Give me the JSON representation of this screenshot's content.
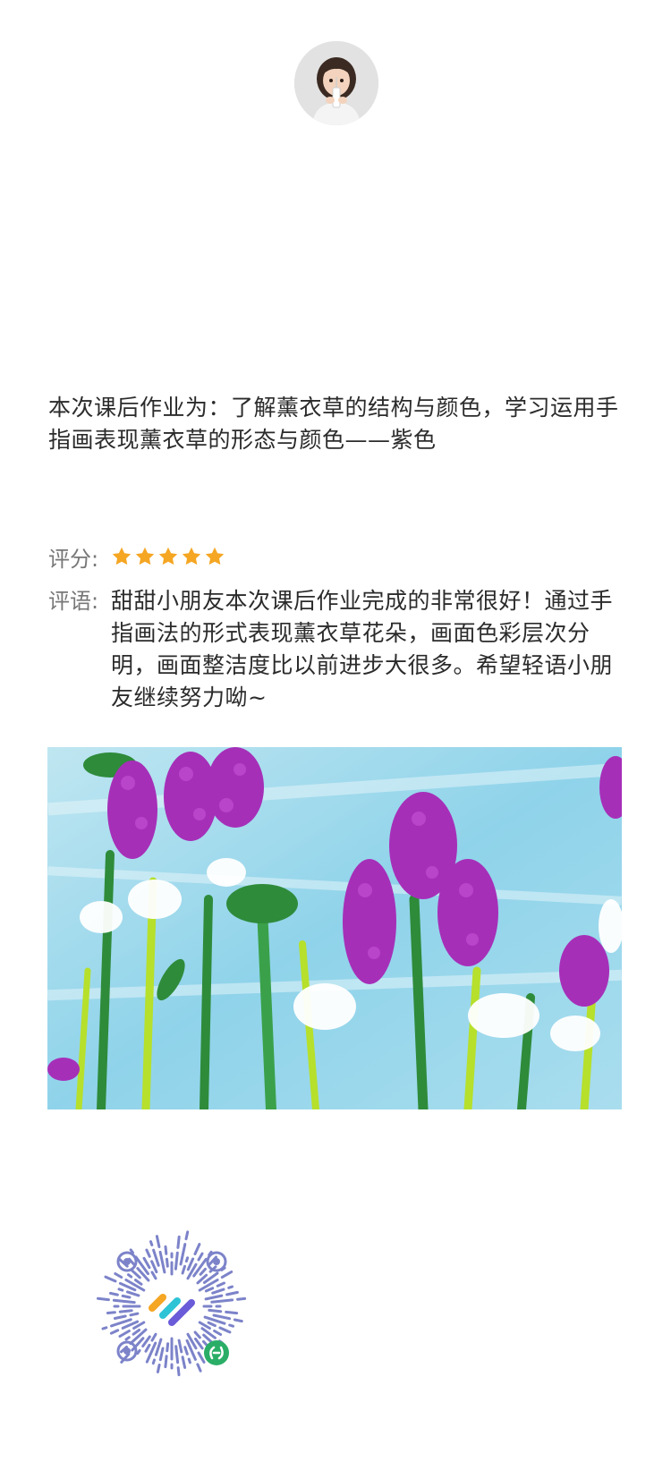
{
  "task": {
    "text": "本次课后作业为：了解薰衣草的结构与颜色，学习运用手指画表现薰衣草的形态与颜色——紫色"
  },
  "score": {
    "label": "评分:",
    "stars": 5,
    "max_stars": 5,
    "star_color": "#F5A623"
  },
  "comment": {
    "label": "评语:",
    "text": "甜甜小朋友本次课后作业完成的非常很好！通过手指画法的形式表现薰衣草花朵，画面色彩层次分明，画面整洁度比以前进步大很多。希望轻语小朋友继续努力呦~"
  },
  "colors": {
    "text": "#2b2b2b",
    "label": "#777777",
    "lavender": "#A62FB8",
    "sky": "#9ED8EA",
    "stem_green": "#2E8B3A",
    "lime": "#B6E02B",
    "qr_blue": "#7C83C9",
    "miniprogram_badge": "#2AAE67"
  },
  "icons": {
    "avatar": "child-avatar",
    "star": "star-icon",
    "qr": "mini-program-code-icon",
    "badge": "mini-program-link-icon"
  }
}
